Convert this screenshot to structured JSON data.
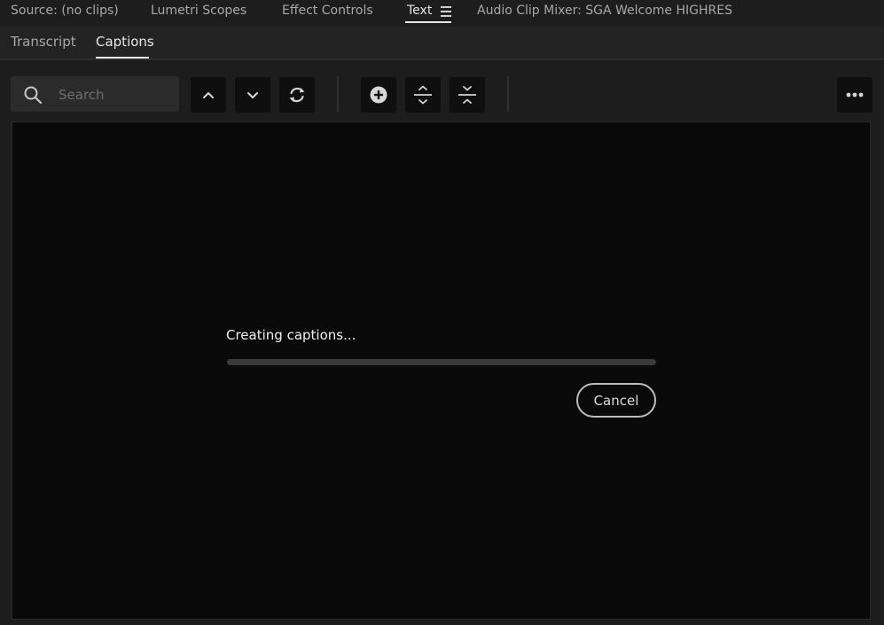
{
  "panel_tabs": [
    {
      "label": "Source: (no clips)"
    },
    {
      "label": "Lumetri Scopes"
    },
    {
      "label": "Effect Controls"
    },
    {
      "label": "Text",
      "active": true
    },
    {
      "label": "Audio Clip Mixer: SGA Welcome HIGHRES"
    }
  ],
  "sub_tabs": [
    {
      "label": "Transcript"
    },
    {
      "label": "Captions",
      "active": true
    }
  ],
  "search": {
    "placeholder": "Search"
  },
  "toolbar": {
    "icons": [
      "chevron-up-icon",
      "chevron-down-icon",
      "refresh-icon",
      "add-circle-icon",
      "split-icon",
      "merge-icon",
      "more-icon"
    ]
  },
  "captions": {
    "status": "Creating captions...",
    "progress": 0.0,
    "cancel_label": "Cancel"
  },
  "colors": {
    "background": "#1d1d1d",
    "content_bg": "#0a0a0a",
    "button_bg": "#0f0f0f",
    "text_active": "#e6e6e6",
    "text_inactive": "#a8a8a8"
  }
}
